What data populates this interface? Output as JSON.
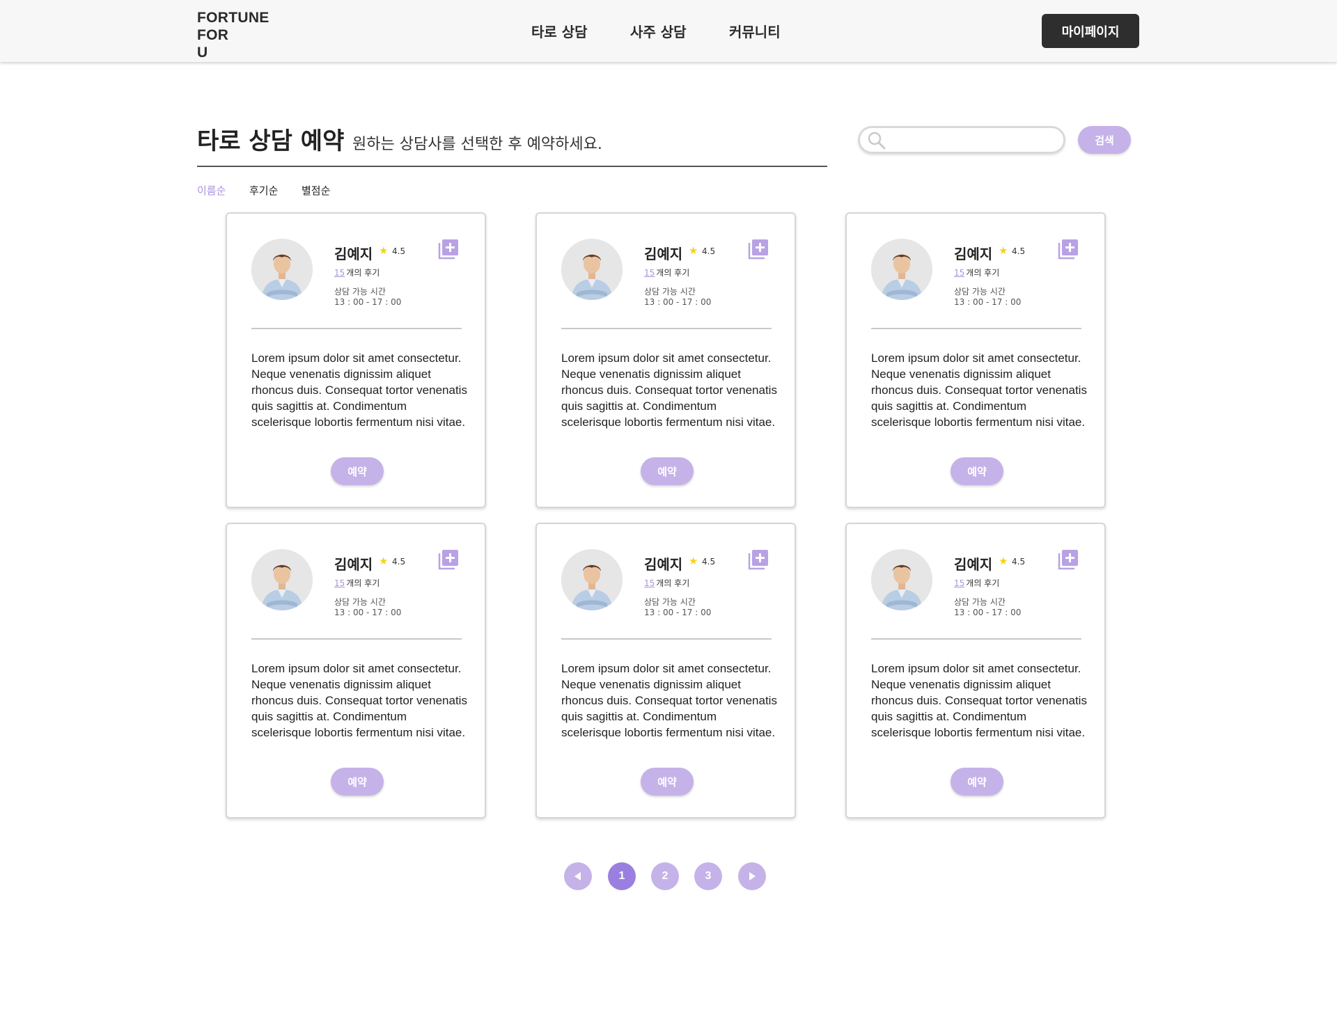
{
  "header": {
    "logo_lines": [
      "FORTUNE",
      "FOR",
      "U"
    ],
    "nav": [
      "타로 상담",
      "사주 상담",
      "커뮤니티"
    ],
    "mypage_label": "마이페이지"
  },
  "page": {
    "title": "타로 상담 예약",
    "subtitle": "원하는 상담사를 선택한 후 예약하세요.",
    "search_placeholder": "",
    "search_button": "검색",
    "sort_options": [
      "이름순",
      "후기순",
      "별점순"
    ],
    "sort_active": "이름순"
  },
  "cards": [
    {
      "name": "김예지",
      "rating": "4.5",
      "review_count": "15",
      "review_suffix": "개의 후기",
      "avail_label": "상담 가능 시간",
      "avail_time": "13 : 00 - 17 : 00",
      "description": "Lorem ipsum dolor sit amet consectetur. Neque venenatis dignissim aliquet rhoncus duis. Consequat tortor venenatis quis sagittis at. Condimentum scelerisque lobortis fermentum nisi vitae.",
      "reserve_label": "예약"
    },
    {
      "name": "김예지",
      "rating": "4.5",
      "review_count": "15",
      "review_suffix": "개의 후기",
      "avail_label": "상담 가능 시간",
      "avail_time": "13 : 00 - 17 : 00",
      "description": "Lorem ipsum dolor sit amet consectetur. Neque venenatis dignissim aliquet rhoncus duis. Consequat tortor venenatis quis sagittis at. Condimentum scelerisque lobortis fermentum nisi vitae.",
      "reserve_label": "예약"
    },
    {
      "name": "김예지",
      "rating": "4.5",
      "review_count": "15",
      "review_suffix": "개의 후기",
      "avail_label": "상담 가능 시간",
      "avail_time": "13 : 00 - 17 : 00",
      "description": "Lorem ipsum dolor sit amet consectetur. Neque venenatis dignissim aliquet rhoncus duis. Consequat tortor venenatis quis sagittis at. Condimentum scelerisque lobortis fermentum nisi vitae.",
      "reserve_label": "예약"
    },
    {
      "name": "김예지",
      "rating": "4.5",
      "review_count": "15",
      "review_suffix": "개의 후기",
      "avail_label": "상담 가능 시간",
      "avail_time": "13 : 00 - 17 : 00",
      "description": "Lorem ipsum dolor sit amet consectetur. Neque venenatis dignissim aliquet rhoncus duis. Consequat tortor venenatis quis sagittis at. Condimentum scelerisque lobortis fermentum nisi vitae.",
      "reserve_label": "예약"
    },
    {
      "name": "김예지",
      "rating": "4.5",
      "review_count": "15",
      "review_suffix": "개의 후기",
      "avail_label": "상담 가능 시간",
      "avail_time": "13 : 00 - 17 : 00",
      "description": "Lorem ipsum dolor sit amet consectetur. Neque venenatis dignissim aliquet rhoncus duis. Consequat tortor venenatis quis sagittis at. Condimentum scelerisque lobortis fermentum nisi vitae.",
      "reserve_label": "예약"
    },
    {
      "name": "김예지",
      "rating": "4.5",
      "review_count": "15",
      "review_suffix": "개의 후기",
      "avail_label": "상담 가능 시간",
      "avail_time": "13 : 00 - 17 : 00",
      "description": "Lorem ipsum dolor sit amet consectetur. Neque venenatis dignissim aliquet rhoncus duis. Consequat tortor venenatis quis sagittis at. Condimentum scelerisque lobortis fermentum nisi vitae.",
      "reserve_label": "예약"
    }
  ],
  "pagination": {
    "pages": [
      "1",
      "2",
      "3"
    ],
    "current": "1",
    "prev_icon": "triangle-left-icon",
    "next_icon": "triangle-right-icon"
  },
  "colors": {
    "accent": "#c5b2e8",
    "accent_strong": "#9b7fe0",
    "accent_text": "#a891dd",
    "dark_button": "#2e2e2e",
    "star": "#f3d21e"
  }
}
